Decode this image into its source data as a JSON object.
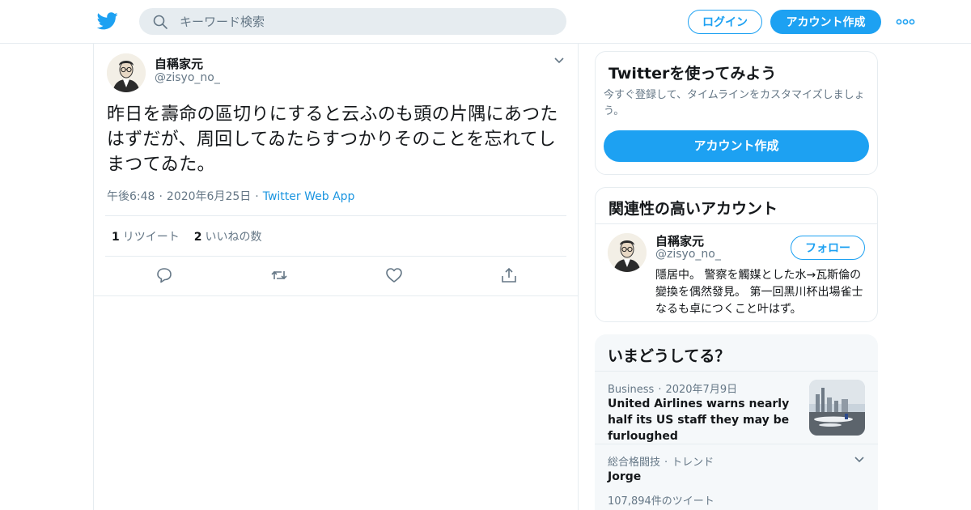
{
  "header": {
    "search_placeholder": "キーワード検索",
    "login_label": "ログイン",
    "signup_label": "アカウント作成"
  },
  "tweet": {
    "author_name": "自稱家元",
    "author_handle": "@zisyo_no_",
    "text": "昨日を壽命の區切りにすると云ふのも頭の片隅にあつたはずだが、周回してゐたらすつかりそのことを忘れてしまつてゐた。",
    "time": "午後6:48",
    "date": "2020年6月25日",
    "source": "Twitter Web App",
    "retweet_count": "1",
    "retweet_label": "リツイート",
    "like_count": "2",
    "like_label": "いいねの数"
  },
  "signup_card": {
    "title": "Twitterを使ってみよう",
    "description": "今すぐ登録して、タイムラインをカスタマイズしましょう。",
    "button_label": "アカウント作成"
  },
  "related_card": {
    "title": "関連性の高いアカウント",
    "name": "自稱家元",
    "handle": "@zisyo_no_",
    "follow_label": "フォロー",
    "bio": "隱居中。 警察を觸媒とした水→瓦斯倫の變換を偶然發見。 第一回黑川杯出場雀士なるも卓につくこと叶はず。"
  },
  "trends_card": {
    "title": "いまどうしてる？",
    "items": [
      {
        "category": "Business",
        "date": "2020年7月9日",
        "title": "United Airlines warns nearly half its US staff they may be furloughed"
      },
      {
        "category": "総合格闘技",
        "label": "トレンド",
        "title": "Jorge",
        "count": "107,894件のツイート"
      }
    ]
  },
  "colors": {
    "accent": "#1da1f2",
    "link": "#1b95e0",
    "muted": "#657786",
    "border": "#e6ecf0"
  },
  "icons": [
    "twitter-bird-icon",
    "search-icon",
    "more-dots-icon",
    "chevron-down-icon",
    "reply-icon",
    "retweet-icon",
    "like-icon",
    "share-icon"
  ]
}
